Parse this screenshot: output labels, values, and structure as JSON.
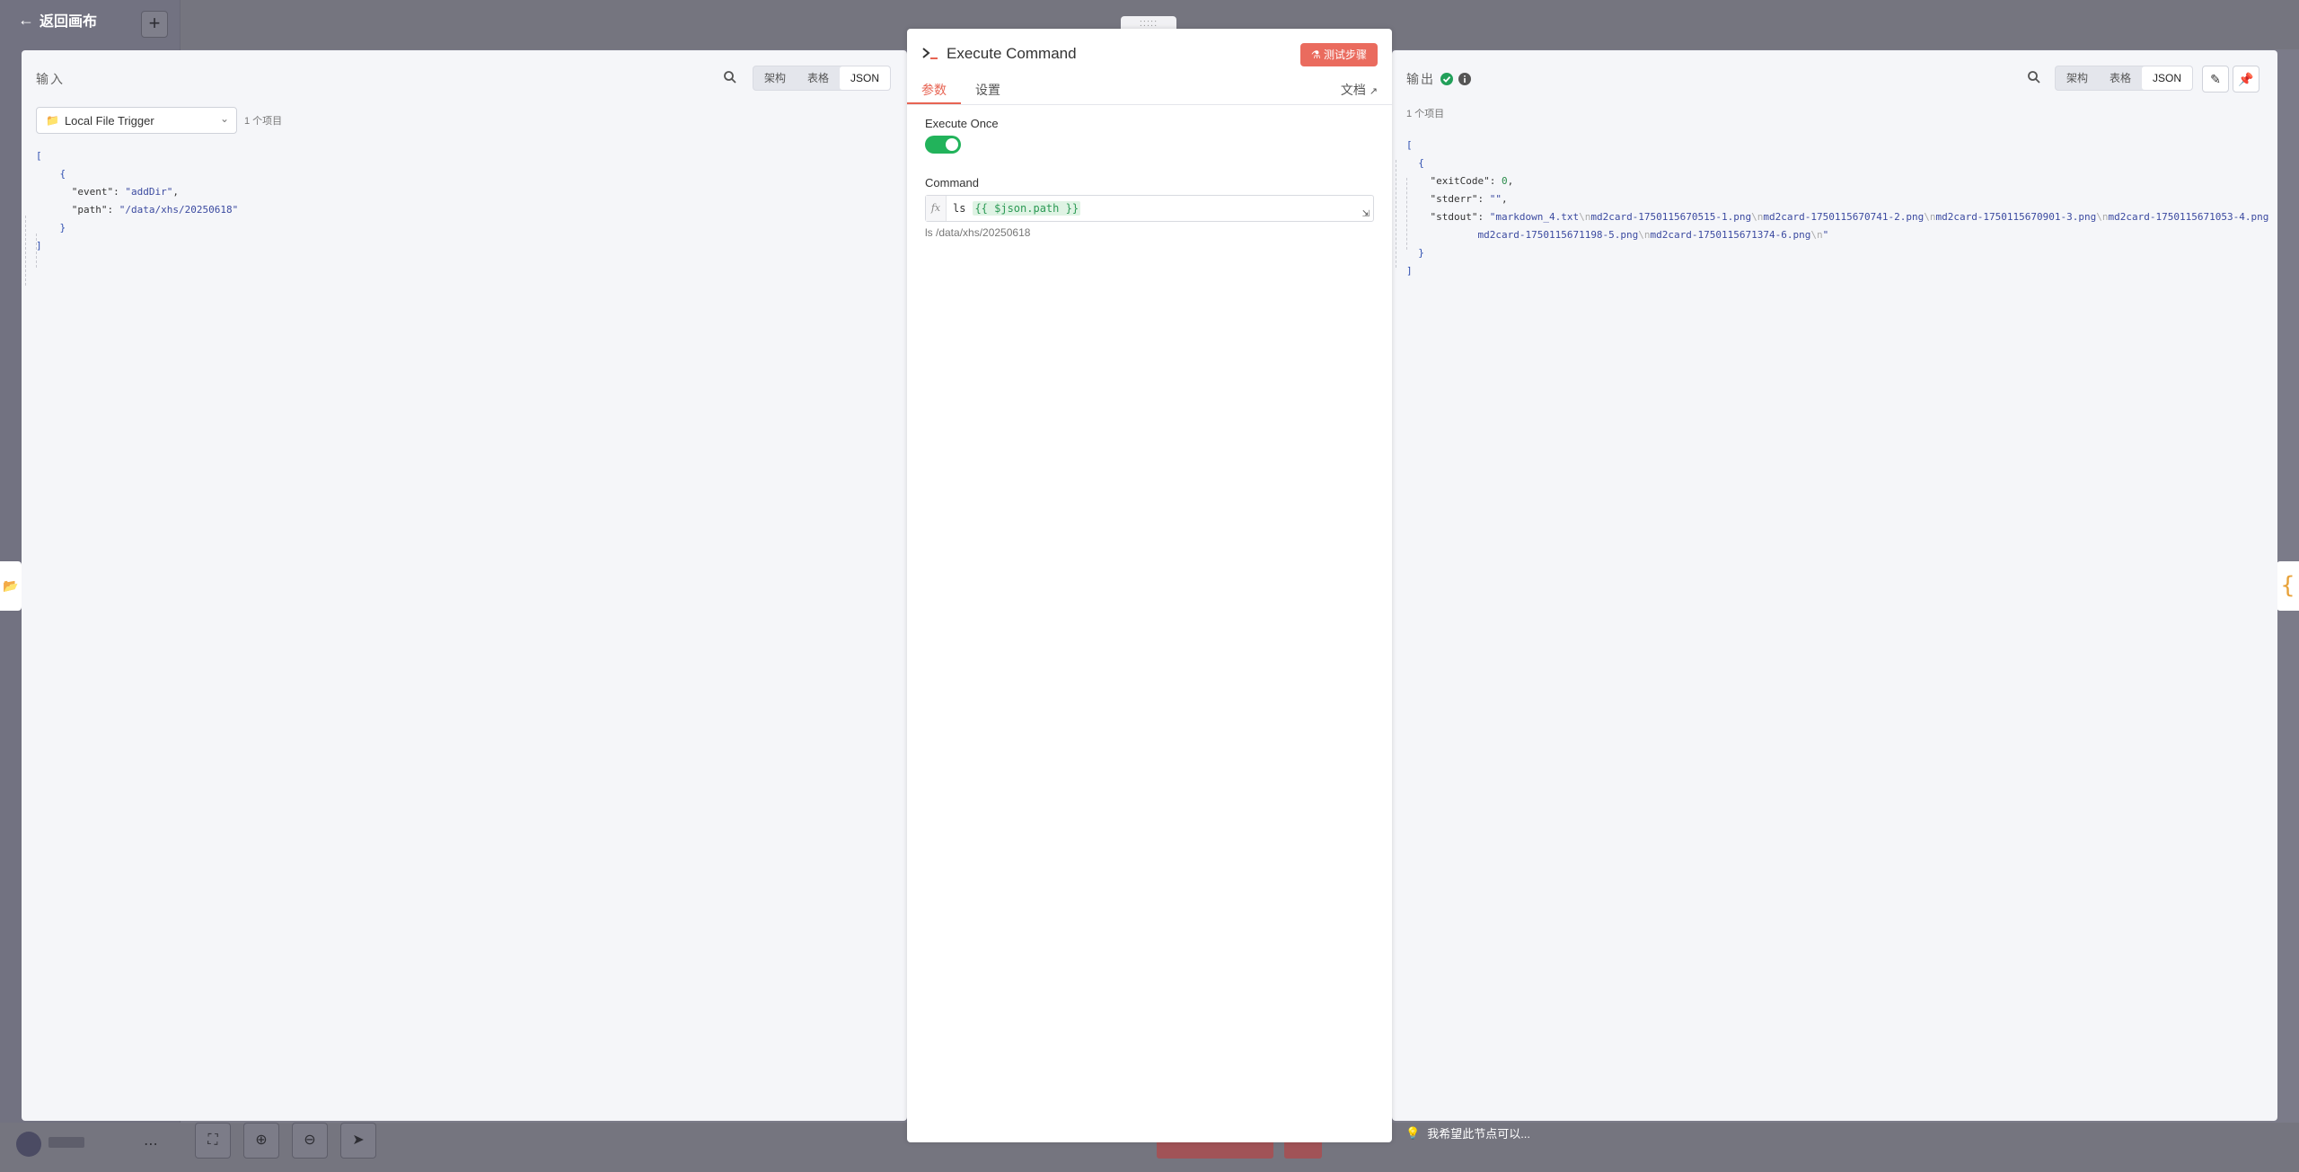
{
  "canvas": {
    "back_label": "返回画布",
    "plus_label": "+",
    "hint_text": "我希望此节点可以..."
  },
  "input_panel": {
    "title": "输入",
    "views": [
      "架构",
      "表格",
      "JSON"
    ],
    "active_view": "JSON",
    "node_select": "Local File Trigger",
    "item_count": "1 个项目",
    "json": {
      "event_key": "\"event\"",
      "event_value": "\"addDir\"",
      "path_key": "\"path\"",
      "path_value": "\"/data/xhs/20250618\""
    }
  },
  "node": {
    "title": "Execute Command",
    "test_button": "测试步骤",
    "tabs": [
      "参数",
      "设置"
    ],
    "active_tab": "参数",
    "docs_link": "文档",
    "execute_once_label": "Execute Once",
    "execute_once_value": true,
    "command_label": "Command",
    "command_prefix": "ls",
    "command_expression": "{{ $json.path }}",
    "command_result": "ls  /data/xhs/20250618"
  },
  "output_panel": {
    "title": "输出",
    "views": [
      "架构",
      "表格",
      "JSON"
    ],
    "active_view": "JSON",
    "item_count": "1 个项目",
    "json": {
      "exitCode_key": "\"exitCode\"",
      "exitCode_value": "0",
      "stderr_key": "\"stderr\"",
      "stderr_value": "\"\"",
      "stdout_key": "\"stdout\"",
      "stdout_files": [
        "markdown_4.txt",
        "md2card-1750115670515-1.png",
        "md2card-1750115670741-2.png",
        "md2card-1750115670901-3.png",
        "md2card-1750115671053-4.png",
        "md2card-1750115671198-5.png",
        "md2card-1750115671374-6.png"
      ]
    }
  },
  "colors": {
    "accent": "#ea6b5e",
    "toggle_on": "#22b35b",
    "success": "#22a05a",
    "json_string": "#3b4aa0",
    "json_number": "#2a8a4a"
  }
}
